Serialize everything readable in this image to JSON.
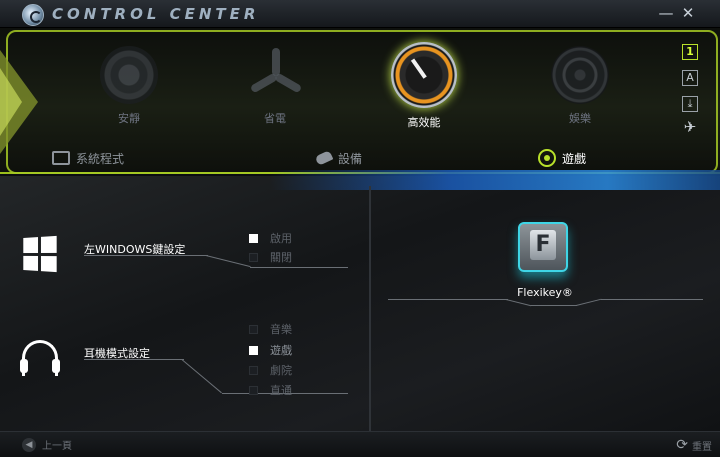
{
  "titlebar": {
    "app_title": "Control Center",
    "minimize": "—",
    "close": "✕"
  },
  "modes": [
    {
      "label": "安靜",
      "active": false,
      "icon": "speaker-icon"
    },
    {
      "label": "省電",
      "active": false,
      "icon": "fan-icon"
    },
    {
      "label": "高效能",
      "active": true,
      "icon": "speedometer-icon"
    },
    {
      "label": "娛樂",
      "active": false,
      "icon": "crosshair-icon"
    }
  ],
  "side_icons": [
    {
      "glyph": "1",
      "icon": "display-1-icon",
      "active": true
    },
    {
      "glyph": "A",
      "icon": "caps-lock-icon",
      "active": false
    },
    {
      "glyph": "⤓",
      "icon": "scroll-lock-icon",
      "active": false
    },
    {
      "glyph": "✈",
      "icon": "airplane-mode-icon",
      "active": false
    }
  ],
  "tabs": {
    "system": "系統程式",
    "devices": "設備",
    "gaming": "遊戲"
  },
  "windows_key": {
    "title": "左WINDOWS鍵設定",
    "options": [
      {
        "label": "啟用",
        "checked": true
      },
      {
        "label": "關閉",
        "checked": false
      }
    ]
  },
  "headset": {
    "title": "耳機模式設定",
    "options": [
      {
        "label": "音樂",
        "checked": false
      },
      {
        "label": "遊戲",
        "checked": true
      },
      {
        "label": "劇院",
        "checked": false
      },
      {
        "label": "直通",
        "checked": false
      }
    ]
  },
  "flexikey": {
    "key_glyph": "F",
    "label": "Flexikey®"
  },
  "footer": {
    "back": "上一頁",
    "back_glyph": "◀",
    "reset": "重置",
    "reset_glyph": "⟳"
  }
}
